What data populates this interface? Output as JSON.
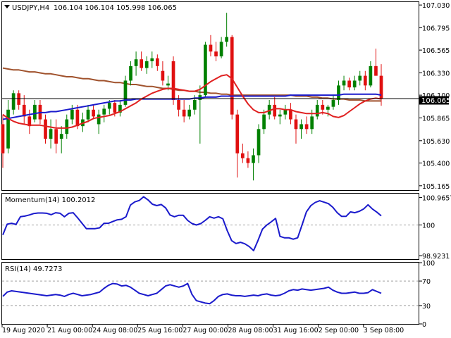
{
  "chart_data": [
    {
      "panel": "price",
      "type": "candlestick",
      "symbol_label": "USDJPY,H4",
      "ohlc_label": "106.104 106.104 105.998 106.065",
      "last_price_label": "106.065",
      "last_price": 106.065,
      "ylim": [
        105.12,
        107.06
      ],
      "y_ticks": [
        105.165,
        105.4,
        105.63,
        105.865,
        106.1,
        106.33,
        106.565,
        106.795,
        107.03
      ],
      "y_tick_labels": [
        "105.165",
        "105.400",
        "105.630",
        "105.865",
        "106.100",
        "106.330",
        "106.565",
        "106.795",
        "107.030"
      ],
      "grid": false,
      "colors": {
        "up": "#008000",
        "down": "#e01010",
        "ma_fast": "#e02020",
        "ma_mid": "#1a1acc",
        "ma_slow": "#a0522d",
        "price_line": "#000000"
      },
      "candles": [
        [
          105.8,
          105.9,
          105.35,
          105.5
        ],
        [
          105.55,
          106.05,
          105.5,
          105.95
        ],
        [
          105.95,
          106.15,
          105.9,
          106.12
        ],
        [
          106.12,
          106.15,
          105.95,
          106.0
        ],
        [
          106.0,
          106.1,
          105.8,
          105.88
        ],
        [
          105.88,
          105.95,
          105.7,
          105.78
        ],
        [
          105.85,
          106.05,
          105.82,
          106.0
        ],
        [
          106.0,
          106.05,
          105.8,
          105.85
        ],
        [
          105.85,
          105.9,
          105.6,
          105.65
        ],
        [
          105.65,
          105.85,
          105.55,
          105.75
        ],
        [
          105.75,
          105.85,
          105.5,
          105.6
        ],
        [
          105.65,
          105.78,
          105.5,
          105.7
        ],
        [
          105.7,
          105.9,
          105.65,
          105.85
        ],
        [
          105.85,
          106.0,
          105.8,
          105.95
        ],
        [
          105.95,
          106.0,
          105.75,
          105.78
        ],
        [
          105.78,
          105.92,
          105.72,
          105.85
        ],
        [
          105.85,
          106.0,
          105.82,
          105.95
        ],
        [
          105.95,
          106.0,
          105.85,
          105.88
        ],
        [
          105.8,
          105.95,
          105.7,
          105.9
        ],
        [
          105.9,
          106.0,
          105.82,
          105.96
        ],
        [
          105.96,
          106.05,
          105.9,
          106.02
        ],
        [
          106.02,
          106.05,
          105.88,
          105.92
        ],
        [
          105.92,
          106.05,
          105.88,
          106.0
        ],
        [
          106.0,
          106.3,
          105.98,
          106.25
        ],
        [
          106.25,
          106.45,
          106.2,
          106.4
        ],
        [
          106.4,
          106.55,
          106.3,
          106.47
        ],
        [
          106.47,
          106.55,
          106.35,
          106.38
        ],
        [
          106.38,
          106.5,
          106.32,
          106.45
        ],
        [
          106.45,
          106.55,
          106.38,
          106.48
        ],
        [
          106.48,
          106.52,
          106.35,
          106.4
        ],
        [
          106.35,
          106.45,
          106.2,
          106.25
        ],
        [
          106.2,
          106.3,
          106.15,
          106.22
        ],
        [
          106.45,
          106.5,
          106.0,
          106.05
        ],
        [
          106.05,
          106.1,
          105.88,
          105.95
        ],
        [
          105.95,
          106.05,
          105.82,
          105.88
        ],
        [
          105.88,
          106.0,
          105.85,
          105.95
        ],
        [
          105.95,
          106.1,
          105.9,
          106.05
        ],
        [
          106.05,
          106.2,
          105.6,
          106.1
        ],
        [
          106.1,
          106.65,
          106.08,
          106.62
        ],
        [
          106.62,
          106.72,
          106.5,
          106.55
        ],
        [
          106.55,
          106.65,
          106.45,
          106.5
        ],
        [
          106.5,
          106.7,
          106.48,
          106.65
        ],
        [
          106.65,
          106.95,
          106.6,
          106.7
        ],
        [
          106.7,
          106.72,
          105.85,
          105.9
        ],
        [
          105.9,
          105.95,
          105.25,
          105.5
        ],
        [
          105.5,
          105.6,
          105.4,
          105.45
        ],
        [
          105.45,
          105.52,
          105.35,
          105.4
        ],
        [
          105.4,
          105.55,
          105.22,
          105.48
        ],
        [
          105.48,
          105.8,
          105.4,
          105.75
        ],
        [
          105.75,
          105.95,
          105.7,
          105.9
        ],
        [
          105.9,
          106.05,
          105.85,
          106.0
        ],
        [
          106.0,
          106.08,
          105.85,
          105.88
        ],
        [
          105.88,
          105.95,
          105.8,
          105.9
        ],
        [
          105.9,
          106.0,
          105.85,
          105.95
        ],
        [
          105.95,
          106.02,
          105.8,
          105.85
        ],
        [
          105.85,
          105.9,
          105.6,
          105.75
        ],
        [
          105.75,
          105.85,
          105.65,
          105.8
        ],
        [
          105.8,
          105.88,
          105.7,
          105.75
        ],
        [
          105.75,
          105.95,
          105.7,
          105.88
        ],
        [
          105.88,
          106.05,
          105.85,
          106.0
        ],
        [
          106.0,
          106.05,
          105.9,
          105.95
        ],
        [
          105.95,
          106.0,
          105.88,
          105.98
        ],
        [
          105.98,
          106.1,
          105.95,
          106.05
        ],
        [
          106.05,
          106.25,
          106.0,
          106.2
        ],
        [
          106.2,
          106.3,
          106.15,
          106.25
        ],
        [
          106.25,
          106.28,
          106.15,
          106.18
        ],
        [
          106.18,
          106.3,
          106.15,
          106.25
        ],
        [
          106.25,
          106.35,
          106.2,
          106.3
        ],
        [
          106.3,
          106.35,
          106.15,
          106.2
        ],
        [
          106.2,
          106.45,
          106.18,
          106.4
        ],
        [
          106.4,
          106.58,
          106.3,
          106.3
        ],
        [
          106.3,
          106.42,
          105.99,
          106.06
        ]
      ],
      "ma_fast": [
        105.9,
        105.86,
        105.83,
        105.81,
        105.8,
        105.79,
        105.79,
        105.79,
        105.78,
        105.77,
        105.76,
        105.76,
        105.76,
        105.77,
        105.79,
        105.81,
        105.83,
        105.86,
        105.87,
        105.88,
        105.89,
        105.91,
        105.93,
        105.96,
        105.99,
        106.02,
        106.06,
        106.09,
        106.12,
        106.14,
        106.16,
        106.17,
        106.17,
        106.16,
        106.15,
        106.14,
        106.14,
        106.16,
        106.2,
        106.24,
        106.27,
        106.3,
        106.31,
        106.27,
        106.18,
        106.09,
        106.01,
        105.95,
        105.92,
        105.92,
        105.94,
        105.96,
        105.96,
        105.95,
        105.95,
        105.93,
        105.92,
        105.91,
        105.91,
        105.91,
        105.92,
        105.91,
        105.88,
        105.87,
        105.89,
        105.93,
        105.97,
        106.01,
        106.04,
        106.06,
        106.07,
        106.06
      ],
      "ma_mid": [
        105.85,
        105.86,
        105.87,
        105.88,
        105.89,
        105.9,
        105.91,
        105.92,
        105.92,
        105.93,
        105.93,
        105.94,
        105.95,
        105.96,
        105.97,
        105.98,
        105.99,
        106.0,
        106.01,
        106.02,
        106.03,
        106.04,
        106.04,
        106.05,
        106.05,
        106.06,
        106.06,
        106.06,
        106.06,
        106.06,
        106.06,
        106.06,
        106.06,
        106.06,
        106.06,
        106.06,
        106.07,
        106.07,
        106.08,
        106.08,
        106.08,
        106.09,
        106.09,
        106.09,
        106.09,
        106.09,
        106.09,
        106.09,
        106.09,
        106.09,
        106.09,
        106.09,
        106.09,
        106.09,
        106.1,
        106.1,
        106.1,
        106.1,
        106.1,
        106.1,
        106.1,
        106.1,
        106.1,
        106.1,
        106.11,
        106.11,
        106.11,
        106.11,
        106.11,
        106.11,
        106.11,
        106.1
      ],
      "ma_slow": [
        106.38,
        106.37,
        106.36,
        106.36,
        106.35,
        106.34,
        106.34,
        106.33,
        106.32,
        106.32,
        106.31,
        106.3,
        106.29,
        106.29,
        106.28,
        106.27,
        106.27,
        106.26,
        106.25,
        106.25,
        106.24,
        106.23,
        106.23,
        106.22,
        106.21,
        106.21,
        106.2,
        106.19,
        106.19,
        106.18,
        106.17,
        106.17,
        106.16,
        106.15,
        106.15,
        106.14,
        106.14,
        106.13,
        106.13,
        106.12,
        106.12,
        106.11,
        106.11,
        106.1,
        106.1,
        106.1,
        106.1,
        106.1,
        106.1,
        106.1,
        106.1,
        106.1,
        106.1,
        106.1,
        106.1,
        106.09,
        106.09,
        106.09,
        106.08,
        106.08,
        106.07,
        106.07,
        106.06,
        106.06,
        106.06,
        106.05,
        106.05,
        106.05,
        106.04,
        106.04,
        106.04,
        106.04
      ]
    },
    {
      "panel": "momentum",
      "type": "line",
      "label": "Momentum(14) 100.2012",
      "ylim": [
        98.8,
        101.1
      ],
      "y_ticks": [
        98.9231,
        100,
        100.9657
      ],
      "y_tick_labels": [
        "98.9231",
        "100",
        "100.9657"
      ],
      "level_lines": [
        100
      ],
      "color": "#1a1acc",
      "values": [
        99.65,
        100.03,
        100.06,
        100.02,
        100.29,
        100.31,
        100.35,
        100.4,
        100.42,
        100.42,
        100.41,
        100.36,
        100.43,
        100.41,
        100.29,
        100.41,
        100.43,
        100.25,
        100.06,
        99.87,
        99.87,
        99.87,
        99.9,
        100.06,
        100.06,
        100.12,
        100.18,
        100.2,
        100.29,
        100.7,
        100.81,
        100.86,
        100.99,
        100.88,
        100.73,
        100.68,
        100.72,
        100.6,
        100.35,
        100.29,
        100.34,
        100.34,
        100.16,
        100.05,
        100.0,
        100.05,
        100.16,
        100.29,
        100.24,
        100.29,
        100.22,
        99.8,
        99.45,
        99.35,
        99.39,
        99.34,
        99.24,
        99.1,
        99.46,
        99.85,
        100.0,
        100.11,
        100.23,
        99.6,
        99.55,
        99.55,
        99.5,
        99.55,
        100.0,
        100.46,
        100.68,
        100.79,
        100.85,
        100.8,
        100.75,
        100.62,
        100.43,
        100.3,
        100.3,
        100.46,
        100.43,
        100.48,
        100.56,
        100.71,
        100.56,
        100.45,
        100.32
      ]
    },
    {
      "panel": "rsi",
      "type": "line",
      "label": "RSI(14) 49.7273",
      "ylim": [
        0,
        100
      ],
      "y_ticks": [
        0,
        30,
        70,
        100
      ],
      "y_tick_labels": [
        "0",
        "30",
        "70",
        "100"
      ],
      "level_lines": [
        30,
        70
      ],
      "color": "#1a1acc",
      "values": [
        45,
        52,
        54,
        53,
        52,
        51,
        50,
        49,
        48,
        47,
        46,
        47,
        48,
        47,
        45,
        48,
        50,
        48,
        46,
        47,
        48,
        50,
        52,
        58,
        63,
        66,
        65,
        62,
        63,
        60,
        55,
        50,
        48,
        46,
        48,
        50,
        56,
        62,
        64,
        62,
        60,
        62,
        66,
        48,
        38,
        36,
        34,
        33,
        38,
        45,
        48,
        49,
        47,
        46,
        46,
        45,
        46,
        47,
        46,
        48,
        49,
        47,
        46,
        47,
        50,
        54,
        56,
        55,
        57,
        56,
        55,
        56,
        57,
        58,
        60,
        55,
        52,
        50,
        50,
        51,
        52,
        50,
        50,
        51,
        56,
        53,
        50
      ]
    },
    {
      "panel": "time_axis",
      "type": "axis",
      "x_tick_labels": [
        "19 Aug 2020",
        "21 Aug 00:00",
        "24 Aug 08:00",
        "25 Aug 16:00",
        "27 Aug 00:00",
        "28 Aug 08:00",
        "31 Aug 16:00",
        "2 Sep 00:00",
        "3 Sep 08:00"
      ]
    }
  ]
}
